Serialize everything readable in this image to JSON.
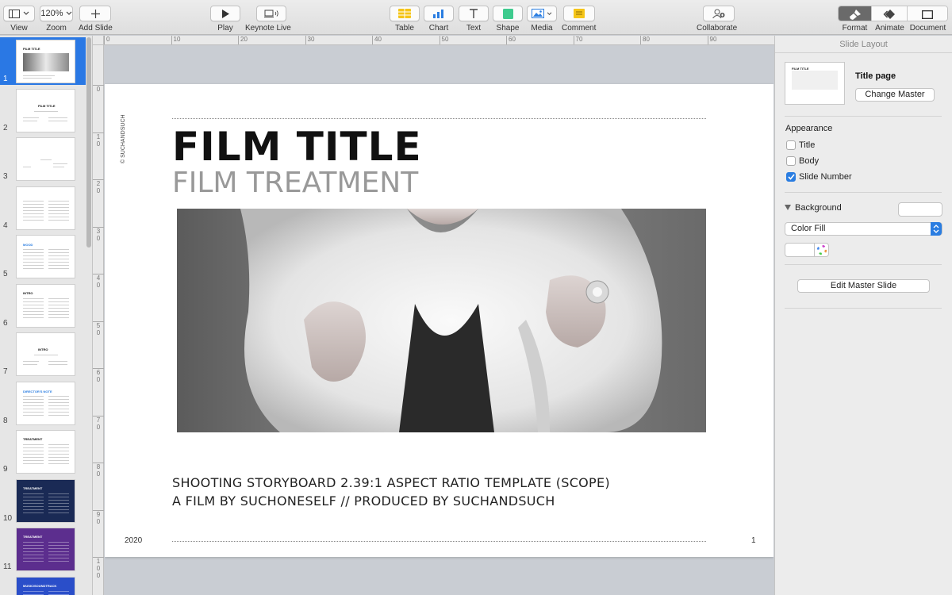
{
  "toolbar": {
    "view": {
      "label": "View"
    },
    "zoom": {
      "label": "Zoom",
      "value": "120%"
    },
    "add_slide": {
      "label": "Add Slide"
    },
    "play": {
      "label": "Play"
    },
    "keynote_live": {
      "label": "Keynote Live"
    },
    "table": {
      "label": "Table"
    },
    "chart": {
      "label": "Chart"
    },
    "text": {
      "label": "Text"
    },
    "shape": {
      "label": "Shape"
    },
    "media": {
      "label": "Media"
    },
    "comment": {
      "label": "Comment"
    },
    "collaborate": {
      "label": "Collaborate"
    },
    "format": {
      "label": "Format"
    },
    "animate": {
      "label": "Animate"
    },
    "document": {
      "label": "Document"
    }
  },
  "colors": {
    "accent": "#2a7de1",
    "comment_yellow": "#f5c518",
    "shape_green": "#3ecb8e",
    "chart_blue": "#2a7de1"
  },
  "navigator": {
    "slides": [
      {
        "num": "1",
        "title": "FILM TITLE",
        "selected": true,
        "style": "light",
        "variant": "title"
      },
      {
        "num": "2",
        "title": "FILM TITLE",
        "selected": false,
        "style": "light",
        "variant": "center"
      },
      {
        "num": "3",
        "title": "",
        "selected": false,
        "style": "light",
        "variant": "sparse"
      },
      {
        "num": "4",
        "title": "",
        "selected": false,
        "style": "light",
        "variant": "text"
      },
      {
        "num": "5",
        "title": "MOOD",
        "selected": false,
        "style": "light",
        "variant": "blue"
      },
      {
        "num": "6",
        "title": "INTRO",
        "selected": false,
        "style": "light",
        "variant": "text"
      },
      {
        "num": "7",
        "title": "INTRO",
        "selected": false,
        "style": "light",
        "variant": "center"
      },
      {
        "num": "8",
        "title": "DIRECTOR'S NOTE",
        "selected": false,
        "style": "light",
        "variant": "blue"
      },
      {
        "num": "9",
        "title": "TREATMENT",
        "selected": false,
        "style": "light",
        "variant": "text"
      },
      {
        "num": "10",
        "title": "TREATMENT",
        "selected": false,
        "style": "dark-navy",
        "variant": "text"
      },
      {
        "num": "11",
        "title": "TREATMENT",
        "selected": false,
        "style": "dark-purple",
        "variant": "text"
      },
      {
        "num": "",
        "title": "MUSIC/SOUNDTRACK",
        "selected": false,
        "style": "dark-blue",
        "variant": "text"
      }
    ]
  },
  "ruler": {
    "top_ticks": [
      "0",
      "10",
      "20",
      "30",
      "40",
      "50",
      "60",
      "70",
      "80",
      "90"
    ],
    "left_ticks": [
      "0",
      "10",
      "20",
      "30",
      "40",
      "50",
      "60",
      "70",
      "80",
      "90",
      "100"
    ]
  },
  "slide": {
    "title": "FILM TITLE",
    "subtitle": "FILM TREATMENT",
    "credit": "© SUCHANDSUCH",
    "line1": "SHOOTING STORYBOARD 2.39:1 ASPECT RATIO TEMPLATE (SCOPE)",
    "line2": "A FILM BY SUCHONESELF // PRODUCED BY SUCHANDSUCH",
    "year": "2020",
    "number": "1"
  },
  "inspector": {
    "header": "Slide Layout",
    "master_name": "Title page",
    "change_master": "Change Master",
    "appearance": {
      "title": "Appearance",
      "items": [
        {
          "label": "Title",
          "checked": false
        },
        {
          "label": "Body",
          "checked": false
        },
        {
          "label": "Slide Number",
          "checked": true
        }
      ]
    },
    "background": {
      "title": "Background",
      "fill_type": "Color Fill"
    },
    "edit_master": "Edit Master Slide"
  }
}
